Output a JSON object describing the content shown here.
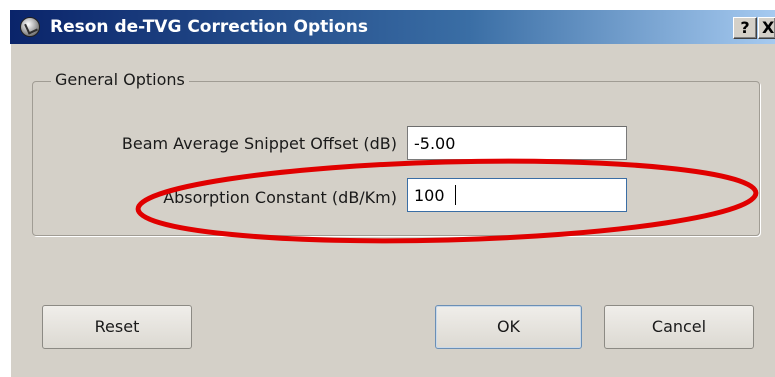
{
  "window": {
    "title": "Reson de-TVG Correction Options",
    "help_label": "?",
    "close_label": "X"
  },
  "group": {
    "title": "General Options"
  },
  "fields": [
    {
      "label": "Beam Average Snippet Offset (dB)",
      "value": "-5.00"
    },
    {
      "label": "Absorption Constant (dB/Km)",
      "value": "100"
    }
  ],
  "buttons": {
    "reset": "Reset",
    "ok": "OK",
    "cancel": "Cancel"
  },
  "colors": {
    "titlebar_start": "#0a246a",
    "titlebar_end": "#a6caf0",
    "dialog_bg": "#d4d0c8",
    "highlight_ellipse": "#e00000"
  },
  "icons": {
    "app": "app-globe-icon",
    "help": "help-icon",
    "close": "close-icon"
  }
}
